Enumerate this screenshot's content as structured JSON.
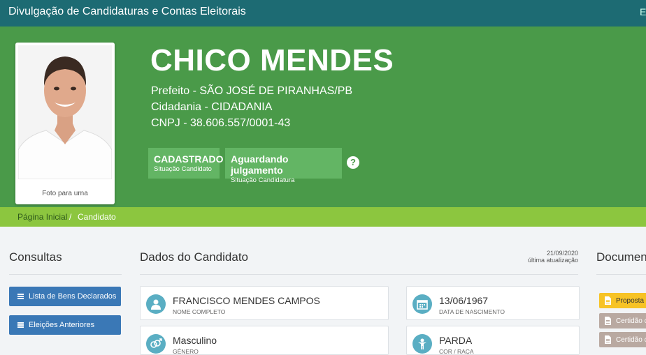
{
  "topbar": {
    "title": "Divulgação de Candidaturas e Contas Eleitorais",
    "edge_text": "E"
  },
  "candidate": {
    "photo_caption": "Foto para urna",
    "name": "CHICO MENDES",
    "office_line": "Prefeito - SÃO JOSÉ DE PIRANHAS/PB",
    "party_line": "Cidadania - CIDADANIA",
    "cnpj_line": "CNPJ - 38.606.557/0001-43",
    "status_candidate": {
      "value": "CADASTRADO",
      "label": "Situação Candidato"
    },
    "status_candidacy": {
      "value": "Aguardando julgamento",
      "label": "Situação Candidatura"
    },
    "help_icon": "?"
  },
  "breadcrumb": {
    "home": "Página Inicial",
    "separator": "/",
    "current": "Candidato"
  },
  "consultas": {
    "title": "Consultas",
    "buttons": [
      {
        "label": "Lista de Bens Declarados",
        "icon": "list-icon"
      },
      {
        "label": "Eleições Anteriores",
        "icon": "list-icon"
      }
    ]
  },
  "dados": {
    "title": "Dados do Candidato",
    "updated_date": "21/09/2020",
    "updated_label": "última atualização",
    "fields": [
      {
        "value": "FRANCISCO MENDES CAMPOS",
        "label": "NOME COMPLETO",
        "icon": "user-icon"
      },
      {
        "value": "13/06/1967",
        "label": "DATA DE NASCIMENTO",
        "icon": "calendar-icon"
      },
      {
        "value": "Masculino",
        "label": "GÊNERO",
        "icon": "gender-icon"
      },
      {
        "value": "PARDA",
        "label": "COR / RAÇA",
        "icon": "person-icon"
      }
    ]
  },
  "documentos": {
    "title": "Documentos",
    "items": [
      {
        "label": "Proposta",
        "color": "#f7c325"
      },
      {
        "label": "Certidão c",
        "color": "#b9a9a1"
      },
      {
        "label": "Certidão c",
        "color": "#b9a9a1"
      }
    ]
  },
  "colors": {
    "topbar": "#1d6b73",
    "hero": "#4a9a49",
    "badge": "#63b564",
    "breadcrumb": "#8cc63f",
    "button": "#3a78b6",
    "icon_circle": "#5aaec3"
  }
}
